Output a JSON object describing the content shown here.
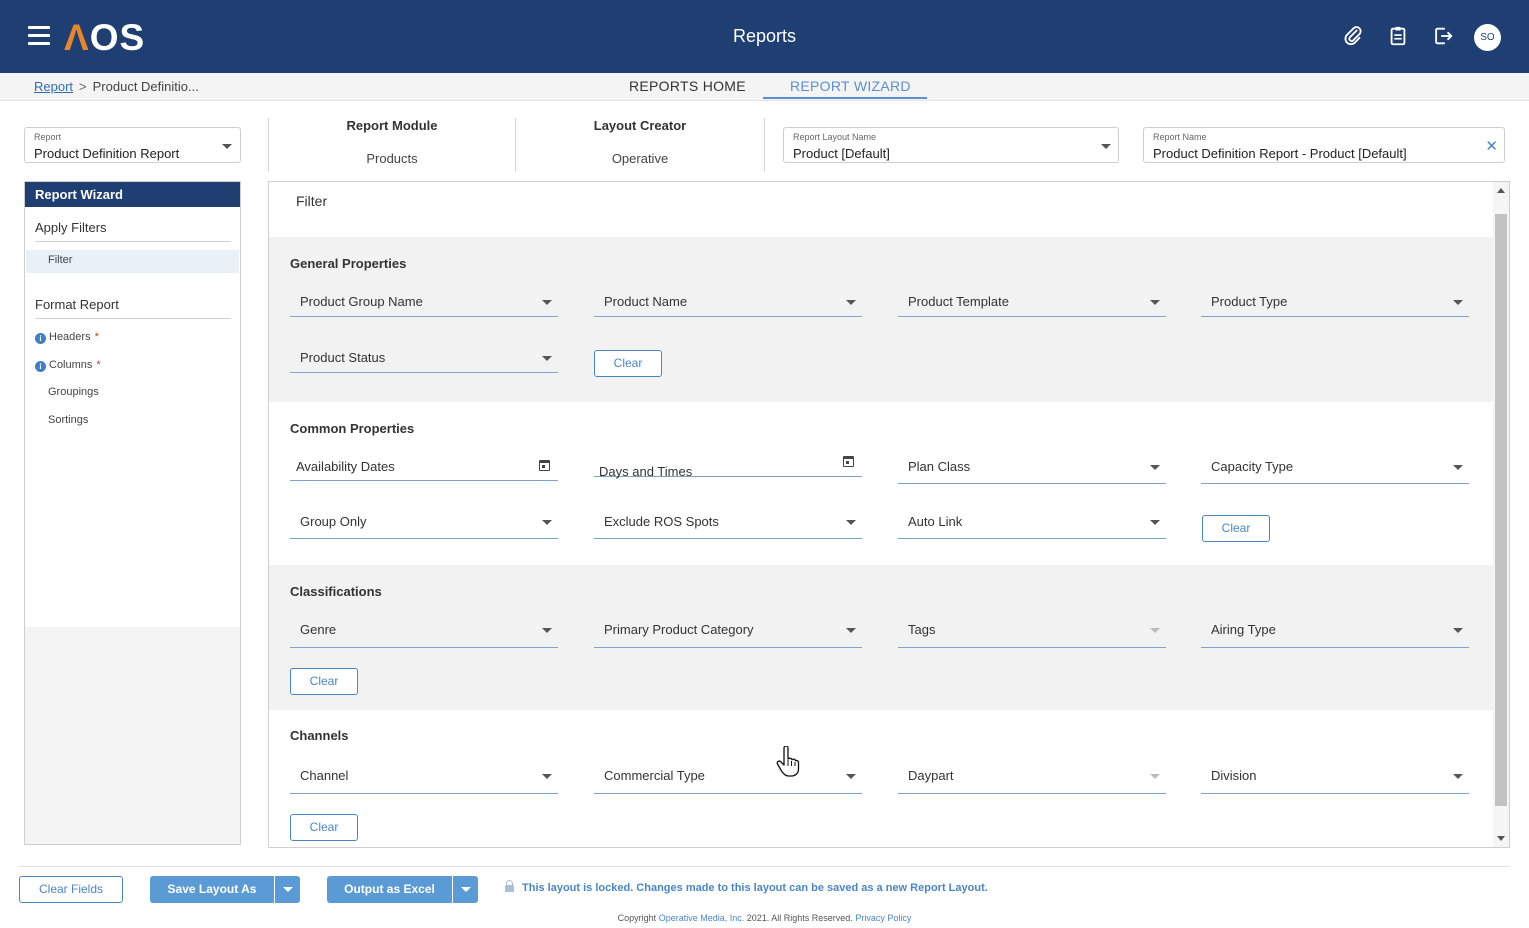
{
  "header": {
    "logo_a": "Λ",
    "logo_os": "OS",
    "title": "Reports",
    "avatar": "SO",
    "icons": [
      "paperclip-icon",
      "clipboard-icon",
      "logout-icon"
    ]
  },
  "breadcrumb": {
    "root": "Report",
    "sep": ">",
    "current": "Product Definitio..."
  },
  "tabs": {
    "home": "REPORTS HOME",
    "wizard": "REPORT WIZARD"
  },
  "report_field": {
    "label": "Report",
    "value": "Product Definition Report"
  },
  "report_module": {
    "label": "Report Module",
    "value": "Products"
  },
  "layout_creator": {
    "label": "Layout Creator",
    "value": "Operative"
  },
  "layout_name": {
    "label": "Report Layout Name",
    "value": "Product [Default]"
  },
  "report_name": {
    "label": "Report Name",
    "value": "Product Definition Report - Product [Default]",
    "clear": "✕"
  },
  "nav": {
    "title": "Report Wizard",
    "apply_filters": "Apply Filters",
    "filter": "Filter",
    "format_report": "Format Report",
    "headers": "Headers",
    "columns": "Columns",
    "groupings": "Groupings",
    "sortings": "Sortings",
    "info": "i",
    "required": "*"
  },
  "main": {
    "title": "Filter",
    "clear_label": "Clear",
    "general": {
      "title": "General Properties",
      "fields": [
        "Product Group Name",
        "Product Name",
        "Product Template",
        "Product Type",
        "Product Status"
      ]
    },
    "common": {
      "title": "Common Properties",
      "fields": [
        "Availability Dates",
        "Days and Times",
        "Plan Class",
        "Capacity Type",
        "Group Only",
        "Exclude ROS Spots",
        "Auto Link"
      ]
    },
    "classifications": {
      "title": "Classifications",
      "fields": [
        "Genre",
        "Primary Product Category",
        "Tags",
        "Airing Type"
      ]
    },
    "channels": {
      "title": "Channels",
      "fields": [
        "Channel",
        "Commercial Type",
        "Daypart",
        "Division"
      ]
    }
  },
  "footer": {
    "clear_fields": "Clear Fields",
    "save_layout": "Save Layout As",
    "output_excel": "Output as Excel",
    "lock_message": "This layout is locked. Changes made to this layout can be saved as a new Report Layout.",
    "copyright_prefix": "Copyright",
    "company": "Operative Media, Inc.",
    "copyright_suffix": "2021. All Rights Reserved.",
    "privacy": "Privacy Policy"
  },
  "colors": {
    "header_bg": "#1f3f73",
    "accent": "#4a86c5",
    "logo_orange": "#e8862c"
  }
}
